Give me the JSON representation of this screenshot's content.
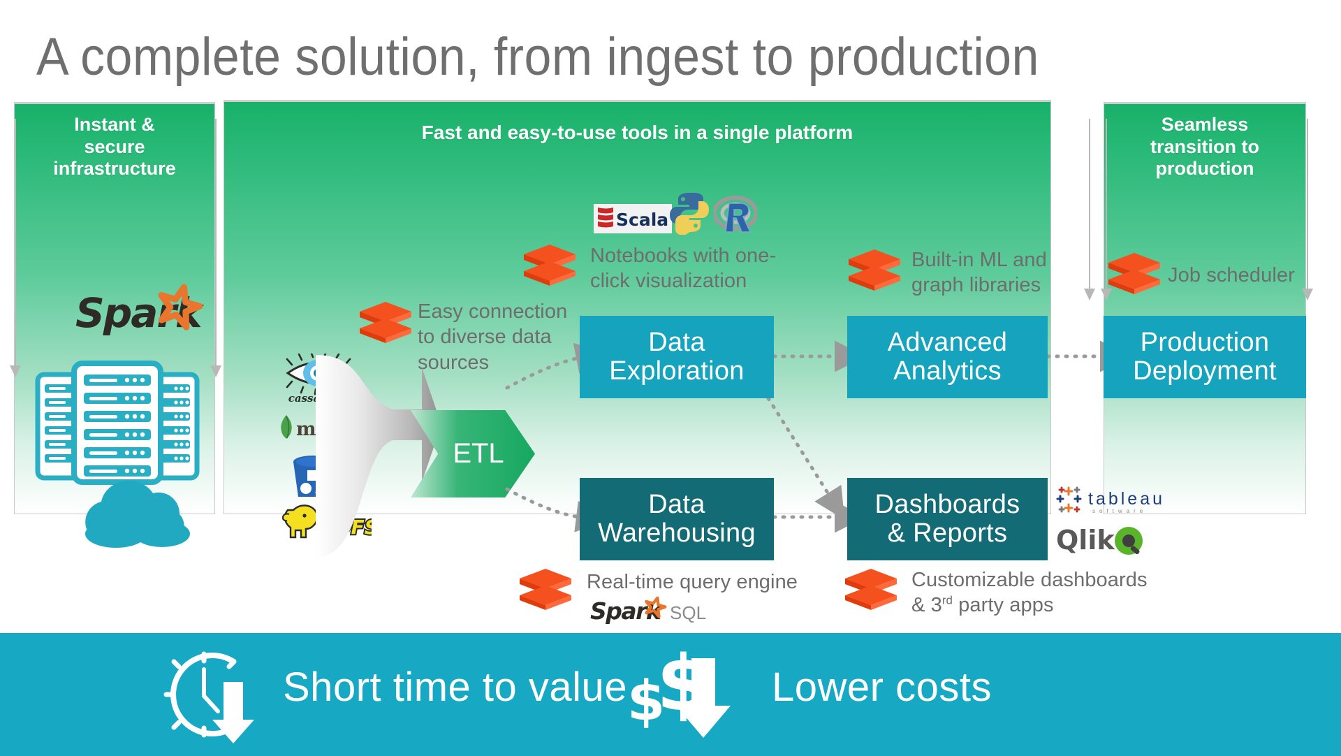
{
  "slide": {
    "title": "A complete solution, from ingest to production"
  },
  "panels": {
    "left": {
      "title_lines": [
        "Instant &",
        "secure",
        "infrastructure"
      ],
      "logo": "Spark",
      "icon": "server-rack-cloud-icon"
    },
    "center": {
      "title_lines": [
        "Fast and easy-to-use tools in a single platform"
      ]
    },
    "right": {
      "title_lines": [
        "Seamless",
        "transition to",
        "production"
      ]
    }
  },
  "captions": {
    "easy_connection": "Easy connection to diverse data sources",
    "notebooks": "Notebooks with one-click visualization",
    "builtin_ml": "Built-in ML and graph libraries",
    "job_scheduler": "Job scheduler",
    "realtime_query": "Real-time query engine",
    "customizable": "Customizable dashboards & 3rd party apps",
    "customizable_line1": "Customizable dashboards",
    "customizable_line2_a": "& 3",
    "customizable_line2_sup": "rd",
    "customizable_line2_b": " party apps"
  },
  "etl": {
    "label": "ETL"
  },
  "boxes": [
    {
      "id": "data-exploration",
      "lines": [
        "Data",
        "Exploration"
      ],
      "color": "#16a3bd"
    },
    {
      "id": "advanced-analytics",
      "lines": [
        "Advanced",
        "Analytics"
      ],
      "color": "#16a3bd"
    },
    {
      "id": "production-deployment",
      "lines": [
        "Production",
        "Deployment"
      ],
      "color": "#16a3bd"
    },
    {
      "id": "data-warehousing",
      "lines": [
        "Data",
        "Warehousing"
      ],
      "color": "#136b75"
    },
    {
      "id": "dashboards-reports",
      "lines": [
        "Dashboards",
        "& Reports"
      ],
      "color": "#136b75"
    }
  ],
  "data_sources": [
    {
      "name": "cassandra",
      "label": "cassandra",
      "icon": "cassandra-eye-icon"
    },
    {
      "name": "mongodb",
      "label": "mongoDB",
      "icon": "mongodb-leaf-icon"
    },
    {
      "name": "s3",
      "label": "",
      "icon": "s3-bucket-icon"
    },
    {
      "name": "hdfs",
      "label": "HDFS",
      "icon": "hadoop-elephant-icon"
    }
  ],
  "languages": [
    {
      "name": "scala",
      "label": "Scala"
    },
    {
      "name": "python",
      "label": ""
    },
    {
      "name": "r",
      "label": "R"
    }
  ],
  "bi_vendors": [
    {
      "name": "tableau",
      "label": "tableau",
      "sub": "software"
    },
    {
      "name": "qlik",
      "label": "Qlik",
      "sub": ""
    }
  ],
  "spark_sql": {
    "word": "Spark",
    "sql": "SQL"
  },
  "banner": {
    "items": [
      {
        "id": "short-time-to-value",
        "label": "Short time to value",
        "icon": "clock-down-arrow-icon"
      },
      {
        "id": "lower-costs",
        "label": "Lower costs",
        "icon": "dollar-down-arrow-icon"
      }
    ]
  },
  "colors": {
    "green_top": "#18b169",
    "teal": "#16a3bd",
    "dark_teal": "#136b75",
    "banner_teal": "#17a8c4",
    "databricks_red": "#f03c16",
    "title_gray": "#6f6f6f",
    "caption_gray": "#6d6d6d"
  }
}
